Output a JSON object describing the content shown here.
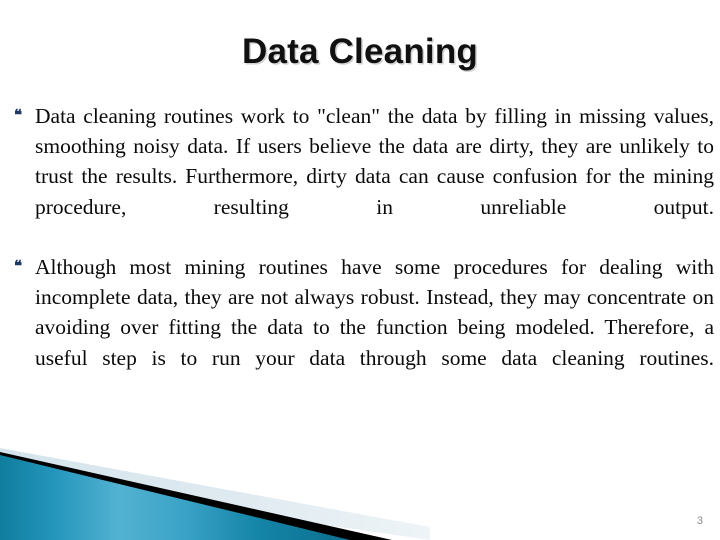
{
  "slide": {
    "title": "Data Cleaning",
    "page_number": "3",
    "bullets": [
      {
        "marker": "❝",
        "text": "Data cleaning routines work to \"clean\" the data by filling in missing values, smoothing noisy data. If users believe the data are dirty, they are unlikely to trust the results. Furthermore, dirty data can cause confusion for the mining procedure, resulting in unreliable output."
      },
      {
        "marker": "❝",
        "text": "Although most mining routines have some procedures for dealing with incomplete data, they are not always robust. Instead, they may concentrate on avoiding over fitting the data to the function being modeled. Therefore, a useful step is to run your data through some data cleaning routines."
      }
    ],
    "colors": {
      "title_text": "#101010",
      "body_text": "#0a0a0a",
      "bullet_marker": "#1f3864",
      "page_number": "#8a8a8a",
      "background": "#ffffff",
      "deco_teal_dark": "#0f7d9e",
      "deco_teal_mid": "#2a9ac0",
      "deco_teal_light": "#5ab6d4",
      "deco_black": "#000000",
      "deco_pale": "#dde8ee"
    }
  }
}
